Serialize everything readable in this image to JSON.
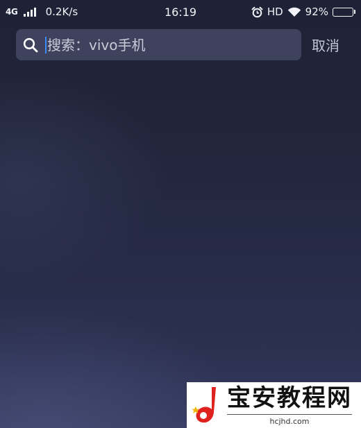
{
  "status_bar": {
    "network": "4G",
    "speed": "0.2K/s",
    "time": "16:19",
    "hd": "HD",
    "battery_text": "92%",
    "battery_level": 0.92,
    "icons": [
      "signal-icon",
      "alarm-icon",
      "wifi-icon",
      "battery-icon"
    ]
  },
  "search": {
    "placeholder": "搜索：vivo手机",
    "cancel_label": "取消"
  },
  "watermark": {
    "title": "宝安教程网",
    "url": "hcjhd.com"
  },
  "colors": {
    "background_top": "#1e2236",
    "background_bottom": "#353b5f",
    "cursor": "#3b8cff",
    "logo_red": "#e0221f",
    "logo_yellow": "#f4b400"
  }
}
